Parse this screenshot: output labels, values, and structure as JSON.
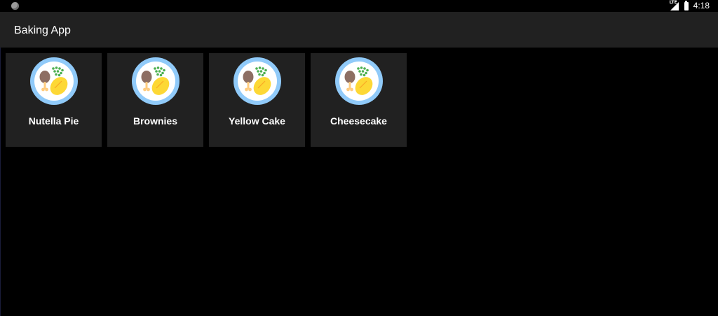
{
  "status_bar": {
    "network_label": "LTE",
    "time": "4:18"
  },
  "app_bar": {
    "title": "Baking App"
  },
  "recipes": [
    {
      "name": "Nutella Pie",
      "icon": "food-plate-icon"
    },
    {
      "name": "Brownies",
      "icon": "food-plate-icon"
    },
    {
      "name": "Yellow Cake",
      "icon": "food-plate-icon"
    },
    {
      "name": "Cheesecake",
      "icon": "food-plate-icon"
    }
  ],
  "colors": {
    "background": "#000000",
    "surface": "#212121",
    "plate_rim": "#90caf9",
    "plate_inner": "#ffffff",
    "drumstick": "#8d6e63",
    "bone": "#ffcc80",
    "peas": "#4caf50",
    "potato": "#fdd835"
  }
}
